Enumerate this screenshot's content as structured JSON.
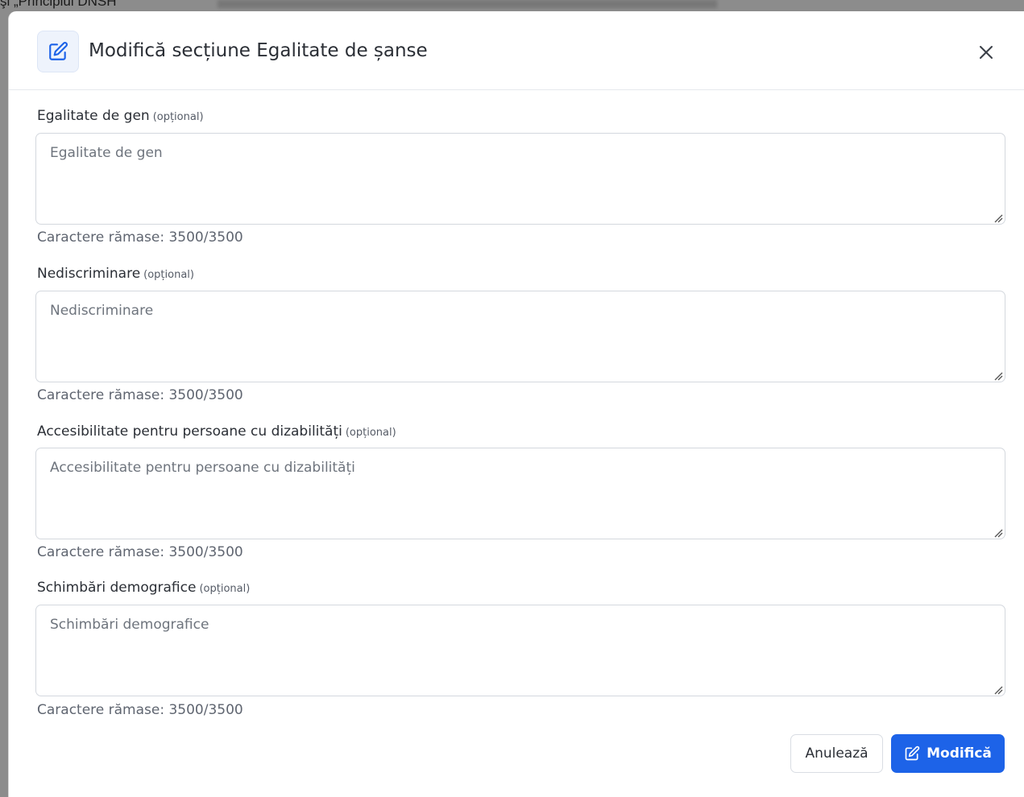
{
  "background": {
    "partial_text": "şi „Principiul DNSH”"
  },
  "modal": {
    "title": "Modifică secțiune Egalitate de șanse",
    "header_icon": "edit-icon",
    "close_icon": "close-icon"
  },
  "fields": [
    {
      "label": "Egalitate de gen",
      "optional_tag": "(opțional)",
      "placeholder": "Egalitate de gen",
      "value": "",
      "counter": "Caractere rămase: 3500/3500"
    },
    {
      "label": "Nediscriminare",
      "optional_tag": "(opțional)",
      "placeholder": "Nediscriminare",
      "value": "",
      "counter": "Caractere rămase: 3500/3500"
    },
    {
      "label": "Accesibilitate pentru persoane cu dizabilități",
      "optional_tag": "(opțional)",
      "placeholder": "Accesibilitate pentru persoane cu dizabilități",
      "value": "",
      "counter": "Caractere rămase: 3500/3500"
    },
    {
      "label": "Schimbări demografice",
      "optional_tag": "(opțional)",
      "placeholder": "Schimbări demografice",
      "value": "",
      "counter": "Caractere rămase: 3500/3500"
    }
  ],
  "footer": {
    "cancel_label": "Anulează",
    "submit_label": "Modifică",
    "submit_icon": "edit-icon"
  },
  "colors": {
    "primary": "#1d63e8",
    "icon_bg": "#eef3fc",
    "border": "#d4d8de",
    "text": "#2b2f36",
    "muted": "#5f6570"
  }
}
